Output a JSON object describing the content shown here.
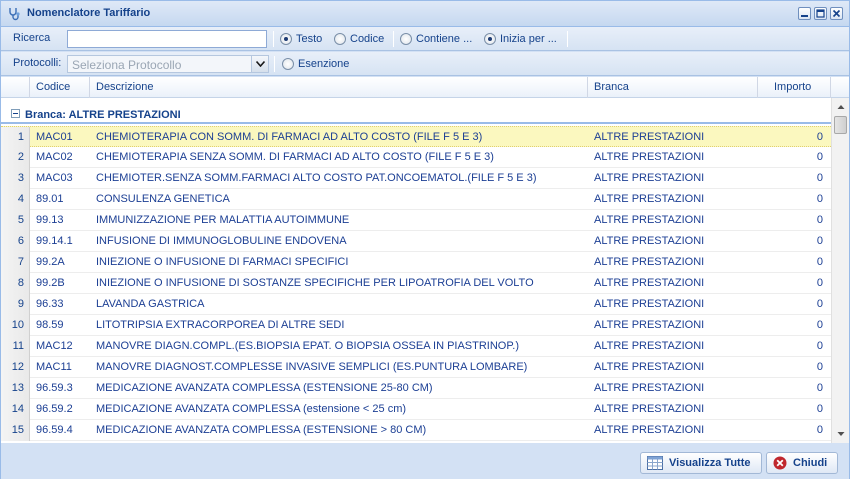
{
  "window": {
    "title": "Nomenclatore Tariffario"
  },
  "search": {
    "label": "Ricerca",
    "value": "",
    "placeholder": "",
    "options": [
      {
        "label": "Testo",
        "checked": true
      },
      {
        "label": "Codice",
        "checked": false
      },
      {
        "label": "Contiene ...",
        "checked": false
      },
      {
        "label": "Inizia per ...",
        "checked": true
      }
    ]
  },
  "protocol": {
    "label": "Protocolli:",
    "placeholder": "Seleziona Protocollo",
    "exemption_label": "Esenzione"
  },
  "grid": {
    "columns": {
      "code": "Codice",
      "description": "Descrizione",
      "branca": "Branca",
      "amount": "Importo"
    },
    "group_label": "Branca: ALTRE PRESTAZIONI",
    "rows": [
      {
        "n": "1",
        "code": "MAC01",
        "description": "CHEMIOTERAPIA CON SOMM. DI FARMACI AD ALTO COSTO (FILE F 5 E 3)",
        "branca": "ALTRE PRESTAZIONI",
        "amount": "0"
      },
      {
        "n": "2",
        "code": "MAC02",
        "description": "CHEMIOTERAPIA SENZA SOMM. DI FARMACI AD ALTO COSTO (FILE F 5 E 3)",
        "branca": "ALTRE PRESTAZIONI",
        "amount": "0"
      },
      {
        "n": "3",
        "code": "MAC03",
        "description": "CHEMIOTER.SENZA SOMM.FARMACI ALTO COSTO PAT.ONCOEMATOL.(FILE F 5 E 3)",
        "branca": "ALTRE PRESTAZIONI",
        "amount": "0"
      },
      {
        "n": "4",
        "code": "89.01",
        "description": "CONSULENZA GENETICA",
        "branca": "ALTRE PRESTAZIONI",
        "amount": "0"
      },
      {
        "n": "5",
        "code": "99.13",
        "description": "IMMUNIZZAZIONE PER MALATTIA AUTOIMMUNE",
        "branca": "ALTRE PRESTAZIONI",
        "amount": "0"
      },
      {
        "n": "6",
        "code": "99.14.1",
        "description": "INFUSIONE DI IMMUNOGLOBULINE ENDOVENA",
        "branca": "ALTRE PRESTAZIONI",
        "amount": "0"
      },
      {
        "n": "7",
        "code": "99.2A",
        "description": "INIEZIONE O INFUSIONE DI FARMACI SPECIFICI",
        "branca": "ALTRE PRESTAZIONI",
        "amount": "0"
      },
      {
        "n": "8",
        "code": "99.2B",
        "description": "INIEZIONE O INFUSIONE DI SOSTANZE SPECIFICHE PER LIPOATROFIA DEL VOLTO",
        "branca": "ALTRE PRESTAZIONI",
        "amount": "0"
      },
      {
        "n": "9",
        "code": "96.33",
        "description": "LAVANDA GASTRICA",
        "branca": "ALTRE PRESTAZIONI",
        "amount": "0"
      },
      {
        "n": "10",
        "code": "98.59",
        "description": "LITOTRIPSIA EXTRACORPOREA DI ALTRE SEDI",
        "branca": "ALTRE PRESTAZIONI",
        "amount": "0"
      },
      {
        "n": "11",
        "code": "MAC12",
        "description": "MANOVRE DIAGN.COMPL.(ES.BIOPSIA EPAT. O BIOPSIA OSSEA IN PIASTRINOP.)",
        "branca": "ALTRE PRESTAZIONI",
        "amount": "0"
      },
      {
        "n": "12",
        "code": "MAC11",
        "description": "MANOVRE DIAGNOST.COMPLESSE INVASIVE SEMPLICI (ES.PUNTURA LOMBARE)",
        "branca": "ALTRE PRESTAZIONI",
        "amount": "0"
      },
      {
        "n": "13",
        "code": "96.59.3",
        "description": "MEDICAZIONE AVANZATA COMPLESSA (ESTENSIONE 25-80 CM)",
        "branca": "ALTRE PRESTAZIONI",
        "amount": "0"
      },
      {
        "n": "14",
        "code": "96.59.2",
        "description": "MEDICAZIONE AVANZATA COMPLESSA (estensione < 25 cm)",
        "branca": "ALTRE PRESTAZIONI",
        "amount": "0"
      },
      {
        "n": "15",
        "code": "96.59.4",
        "description": "MEDICAZIONE AVANZATA COMPLESSA (ESTENSIONE > 80 CM)",
        "branca": "ALTRE PRESTAZIONI",
        "amount": "0"
      }
    ]
  },
  "footer": {
    "show_all_label": "Visualizza Tutte",
    "close_label": "Chiudi"
  },
  "colors": {
    "header_text": "#15428b",
    "selected_row": "#fbf8bf",
    "close_icon": "#c0272d"
  }
}
